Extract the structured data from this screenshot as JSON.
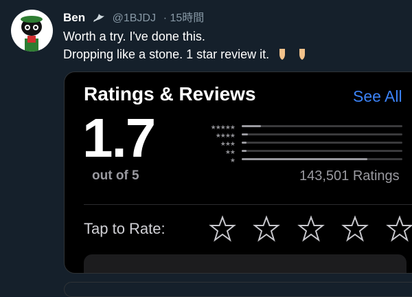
{
  "tweet": {
    "name": "Ben",
    "handle": "@1BJDJ",
    "time": "· 15時間",
    "line1": "Worth a try. I've done this.",
    "line2": "Dropping like a stone. 1 star review it."
  },
  "card": {
    "title": "Ratings & Reviews",
    "see_all": "See All",
    "rating": "1.7",
    "out_of": "out of 5",
    "ratings_count": "143,501 Ratings",
    "star_labels": [
      "★★★★★",
      "★★★★",
      "★★★",
      "★★",
      "★"
    ],
    "bar_fractions": [
      0.12,
      0.04,
      0.03,
      0.03,
      0.78
    ],
    "tap_to_rate": "Tap to Rate:"
  },
  "colors": {
    "background": "#15202b",
    "link": "#3b82f6"
  }
}
